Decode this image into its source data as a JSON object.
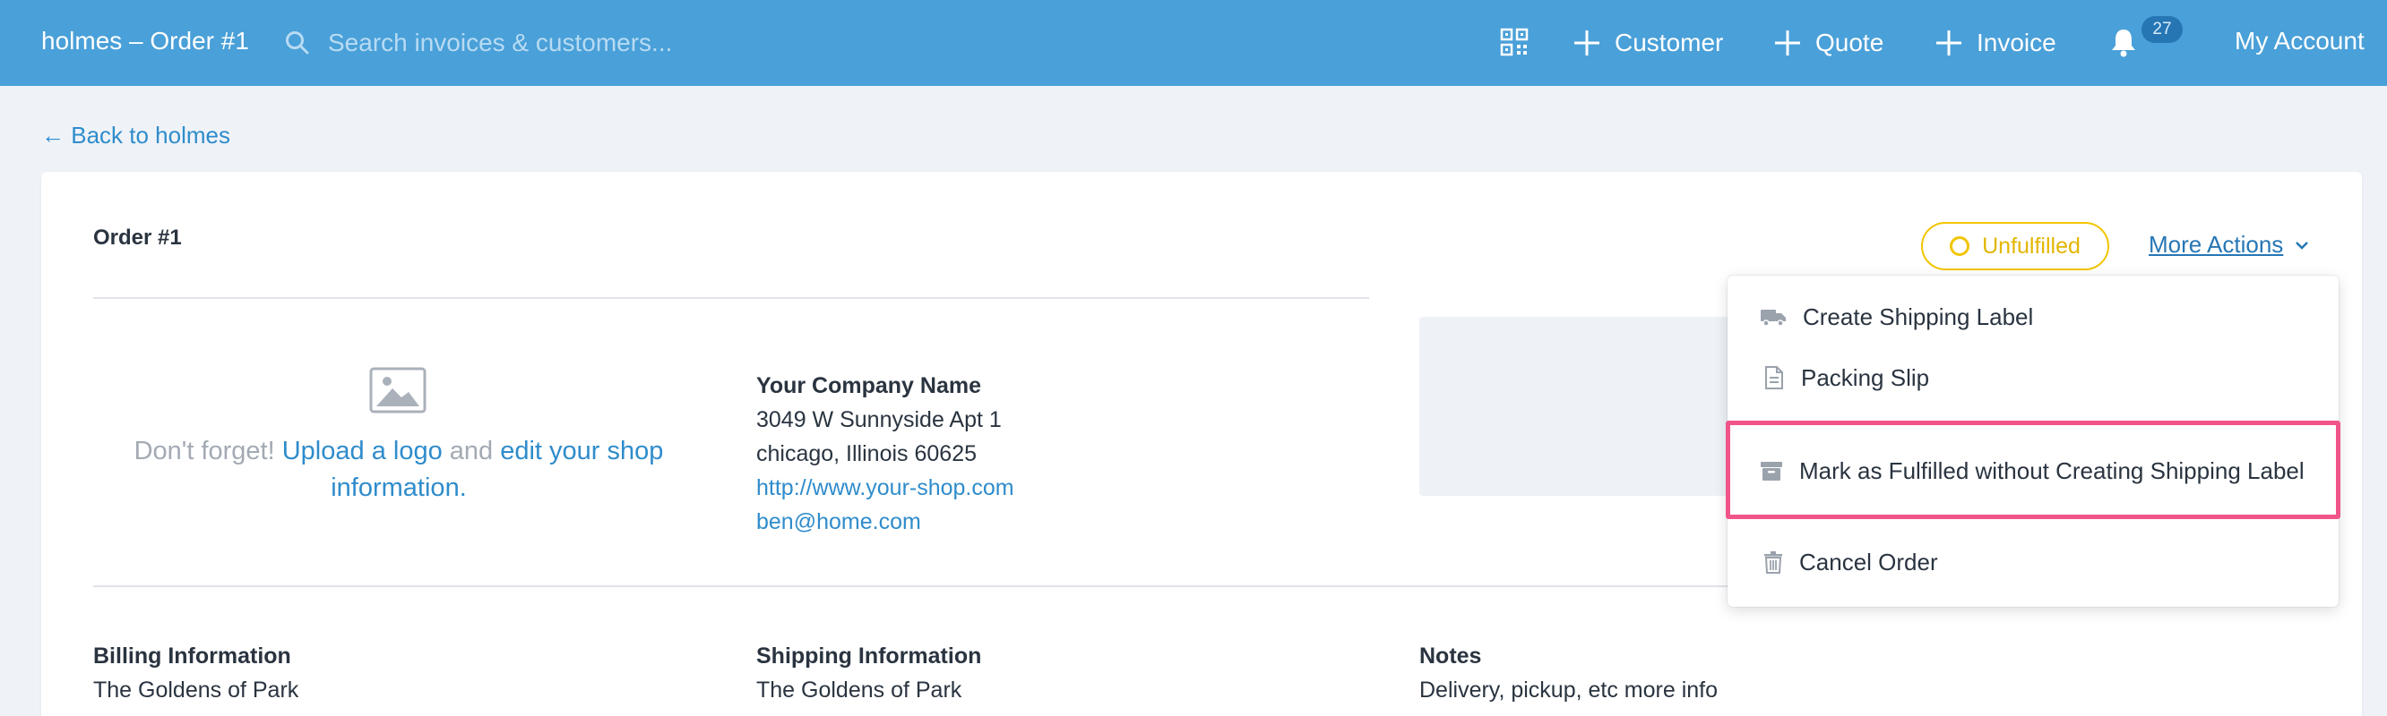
{
  "header": {
    "app_title": "holmes – Order #1",
    "search_placeholder": "Search invoices & customers...",
    "customer_label": "Customer",
    "quote_label": "Quote",
    "invoice_label": "Invoice",
    "notification_count": "27",
    "account_label": "My Account"
  },
  "back_link": "← Back to holmes",
  "order": {
    "title": "Order #1",
    "status": "Unfulfilled",
    "more_actions": "More Actions"
  },
  "logo_hint": {
    "prefix": "Don't forget!",
    "upload_link": "Upload a logo",
    "and": "and",
    "edit_link": "edit your shop information."
  },
  "company": {
    "name": "Your Company Name",
    "address1": "3049 W Sunnyside Apt 1",
    "address2": "chicago, Illinois 60625",
    "website": "http://www.your-shop.com",
    "email": "ben@home.com"
  },
  "billing": {
    "heading": "Billing Information",
    "name": "The Goldens of Park"
  },
  "shipping": {
    "heading": "Shipping Information",
    "name": "The Goldens of Park"
  },
  "notes": {
    "heading": "Notes",
    "text": "Delivery, pickup, etc more info"
  },
  "dropdown": {
    "items": [
      {
        "label": "Create Shipping Label",
        "icon": "truck-icon"
      },
      {
        "label": "Packing Slip",
        "icon": "document-icon"
      },
      {
        "label": "Mark as Fulfilled without Creating Shipping Label",
        "icon": "archive-box-icon"
      },
      {
        "label": "Cancel Order",
        "icon": "trash-icon"
      }
    ]
  },
  "colors": {
    "topbar": "#4aa0d8",
    "link": "#2f8ccb",
    "status": "#f2c500",
    "highlight": "#f0548a"
  }
}
